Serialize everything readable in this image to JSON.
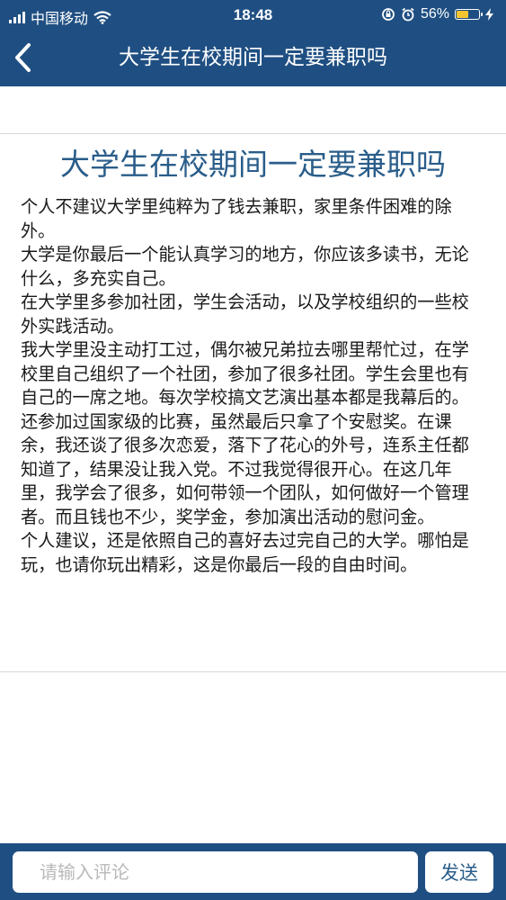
{
  "status_bar": {
    "carrier": "中国移动",
    "time": "18:48",
    "battery_percent": "56%",
    "battery_level": 0.56,
    "icons": [
      "signal-icon",
      "wifi-icon",
      "rotation-lock-icon",
      "alarm-icon",
      "battery-icon",
      "charging-icon"
    ]
  },
  "nav": {
    "title": "大学生在校期间一定要兼职吗",
    "back_icon": "chevron-left-icon"
  },
  "article": {
    "title": "大学生在校期间一定要兼职吗",
    "paragraphs": [
      "个人不建议大学里纯粹为了钱去兼职，家里条件困难的除外。",
      "大学是你最后一个能认真学习的地方，你应该多读书，无论什么，多充实自己。",
      "在大学里多参加社团，学生会活动，以及学校组织的一些校外实践活动。",
      "我大学里没主动打工过，偶尔被兄弟拉去哪里帮忙过，在学校里自己组织了一个社团，参加了很多社团。学生会里也有自己的一席之地。每次学校搞文艺演出基本都是我幕后的。还参加过国家级的比赛，虽然最后只拿了个安慰奖。在课余，我还谈了很多次恋爱，落下了花心的外号，连系主任都知道了，结果没让我入党。不过我觉得很开心。在这几年里，我学会了很多，如何带领一个团队，如何做好一个管理者。而且钱也不少，奖学金，参加演出活动的慰问金。",
      "个人建议，还是依照自己的喜好去过完自己的大学。哪怕是玩，也请你玩出精彩，这是你最后一段的自由时间。"
    ]
  },
  "comment_bar": {
    "placeholder": "请输入评论",
    "value": "",
    "send_label": "发送"
  },
  "colors": {
    "bar_blue": "#1f4f82",
    "title_blue": "#2a5d8a",
    "battery_yellow": "#f4c430"
  }
}
